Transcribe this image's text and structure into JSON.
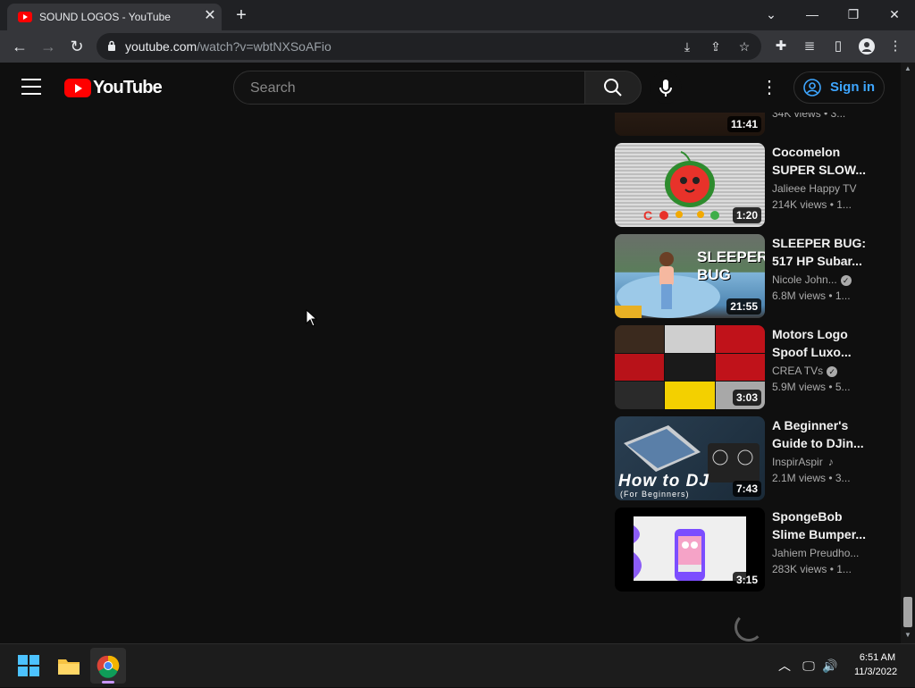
{
  "browser": {
    "tab_title": "SOUND LOGOS - YouTube",
    "url_host": "youtube.com",
    "url_path": "/watch?v=wbtNXSoAFio",
    "icons": [
      "youtube-favicon",
      "tab-close-icon",
      "new-tab-icon",
      "chevron-down-icon",
      "minimize-icon",
      "restore-icon",
      "close-icon",
      "back-icon",
      "forward-icon",
      "reload-icon",
      "lock-icon",
      "install-icon",
      "share-icon",
      "star-icon",
      "extensions-icon",
      "media-icon",
      "side-panel-icon",
      "profile-icon",
      "more-icon"
    ]
  },
  "youtube": {
    "logo_text": "YouTube",
    "search_placeholder": "Search",
    "sign_in_label": "Sign in",
    "colors": {
      "brand_red": "#ff0000",
      "link_blue": "#3ea6ff",
      "background": "#0f0f0f"
    }
  },
  "related": [
    {
      "duration": "11:41",
      "title": "",
      "channel": "",
      "meta": "34K views  • 3...",
      "partial": true
    },
    {
      "duration": "1:20",
      "title": "Cocomelon SUPER SLOW...",
      "channel": "Jalieee Happy TV",
      "verified": false,
      "music": false,
      "meta": "214K views  • 1..."
    },
    {
      "duration": "21:55",
      "title": "SLEEPER BUG: 517 HP Subar...",
      "channel": "Nicole John...",
      "verified": true,
      "music": false,
      "meta": "6.8M views  • 1...",
      "thumb_text": "SLEEPER BUG"
    },
    {
      "duration": "3:03",
      "title": "Motors Logo Spoof Luxo...",
      "channel": "CREA TVs",
      "verified": true,
      "music": false,
      "meta": "5.9M views  • 5..."
    },
    {
      "duration": "7:43",
      "title": "A Beginner's Guide to DJin...",
      "channel": "InspirAspir",
      "verified": false,
      "music": true,
      "meta": "2.1M views  • 3...",
      "thumb_text": "How to DJ",
      "thumb_subtext": "(For Beginners)"
    },
    {
      "duration": "3:15",
      "title": "SpongeBob Slime Bumper...",
      "channel": "Jahiem Preudho...",
      "verified": false,
      "music": false,
      "meta": "283K views  • 1..."
    }
  ],
  "taskbar": {
    "time": "6:51 AM",
    "date": "11/3/2022",
    "icons": [
      "windows-start-icon",
      "file-explorer-icon",
      "chrome-icon",
      "chevron-up-icon",
      "network-icon",
      "volume-icon"
    ]
  }
}
